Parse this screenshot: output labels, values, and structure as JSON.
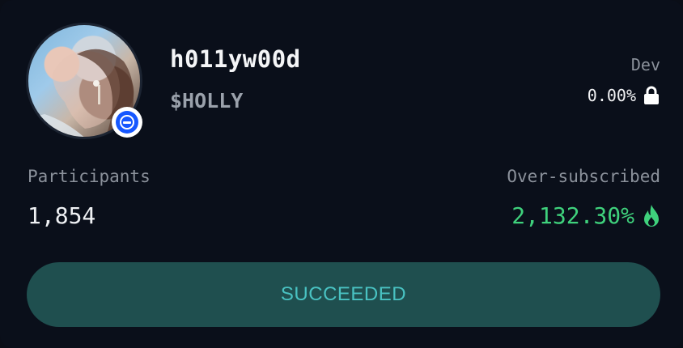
{
  "token": {
    "name": "h011yw00d",
    "ticker": "$HOLLY"
  },
  "dev": {
    "label": "Dev",
    "value": "0.00%"
  },
  "participants": {
    "label": "Participants",
    "value": "1,854"
  },
  "oversubscribed": {
    "label": "Over-subscribed",
    "value": "2,132.30%"
  },
  "status": {
    "label": "SUCCEEDED"
  },
  "colors": {
    "background": "#0a0f1a",
    "accent_green": "#3fd17c",
    "button_bg": "#1f4f4f",
    "button_text": "#49c2c2",
    "badge_blue": "#1657ff"
  },
  "icons": {
    "badge": "blue-circle-minus-icon",
    "lock": "lock-icon",
    "flame": "flame-icon"
  }
}
